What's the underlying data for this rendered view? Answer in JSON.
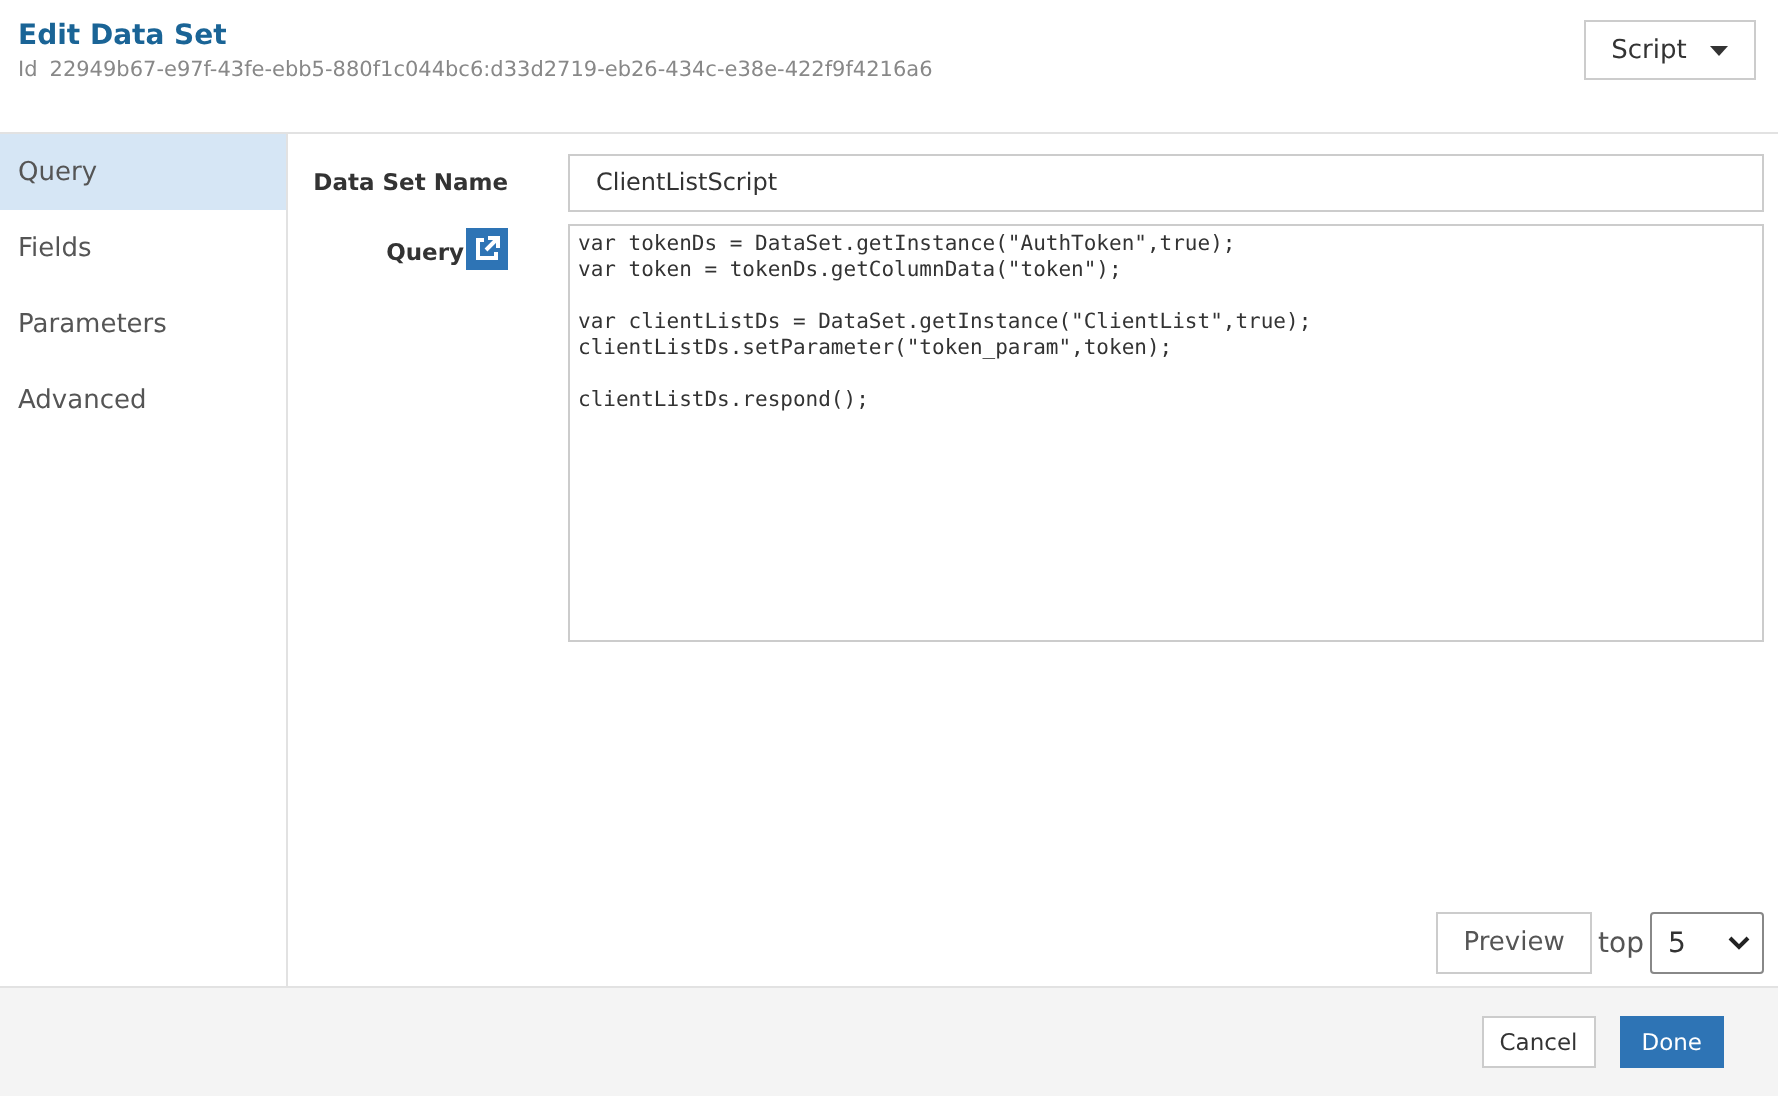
{
  "header": {
    "title": "Edit Data Set",
    "id_label": "Id",
    "id_value": "22949b67-e97f-43fe-ebb5-880f1c044bc6:d33d2719-eb26-434c-e38e-422f9f4216a6",
    "type_dropdown": "Script"
  },
  "sidebar": {
    "items": [
      {
        "label": "Query",
        "selected": true
      },
      {
        "label": "Fields",
        "selected": false
      },
      {
        "label": "Parameters",
        "selected": false
      },
      {
        "label": "Advanced",
        "selected": false
      }
    ]
  },
  "form": {
    "name_label": "Data Set Name",
    "name_value": "ClientListScript",
    "query_label": "Query",
    "query_value": "var tokenDs = DataSet.getInstance(\"AuthToken\",true);\nvar token = tokenDs.getColumnData(\"token\");\n\nvar clientListDs = DataSet.getInstance(\"ClientList\",true);\nclientListDs.setParameter(\"token_param\",token);\n\nclientListDs.respond();"
  },
  "preview": {
    "button": "Preview",
    "top_label": "top",
    "top_value": "5"
  },
  "footer": {
    "buttons": [
      {
        "label": "Cancel",
        "kind": "secondary"
      },
      {
        "label": "Done",
        "kind": "primary"
      }
    ]
  }
}
